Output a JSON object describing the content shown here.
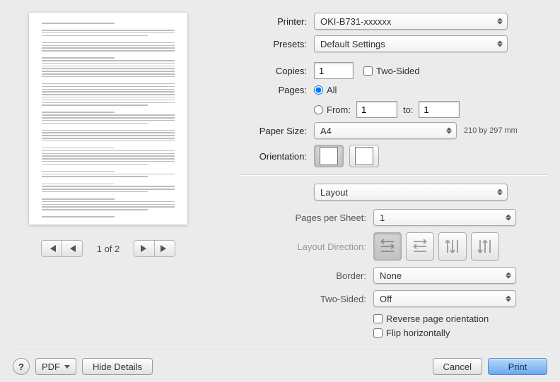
{
  "labels": {
    "printer": "Printer:",
    "presets": "Presets:",
    "copies": "Copies:",
    "two_sided_cb": "Two-Sided",
    "pages": "Pages:",
    "pages_all": "All",
    "pages_from": "From:",
    "pages_to": "to:",
    "paper_size": "Paper Size:",
    "orientation": "Orientation:",
    "section": "Layout",
    "pps": "Pages per Sheet:",
    "layout_dir": "Layout Direction:",
    "border": "Border:",
    "two_sided": "Two-Sided:",
    "reverse": "Reverse page orientation",
    "flip": "Flip horizontally"
  },
  "values": {
    "printer": "OKI-B731-xxxxxx",
    "presets": "Default Settings",
    "copies": "1",
    "from": "1",
    "to": "1",
    "paper_size": "A4",
    "paper_note": "210 by 297 mm",
    "pps": "1",
    "border": "None",
    "two_sided": "Off"
  },
  "preview": {
    "page_indicator": "1 of 2"
  },
  "footer": {
    "help": "?",
    "pdf": "PDF",
    "hide_details": "Hide Details",
    "cancel": "Cancel",
    "print": "Print"
  }
}
